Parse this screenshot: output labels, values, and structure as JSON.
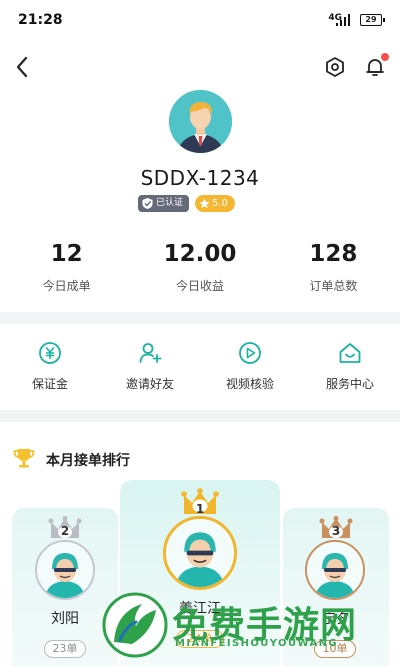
{
  "status_bar": {
    "time": "21:28",
    "network": "4G",
    "battery": "29"
  },
  "nav": {
    "back_icon": "chevron-left-icon",
    "settings_icon": "hexagon-settings-icon",
    "bell_icon": "bell-icon",
    "has_notification": true
  },
  "profile": {
    "username": "SDDX-1234",
    "verified_label": "已认证",
    "rating": "5.0",
    "avatar_icon": "user-avatar-icon"
  },
  "stats": [
    {
      "value": "12",
      "label": "今日成单"
    },
    {
      "value": "12.00",
      "label": "今日收益"
    },
    {
      "value": "128",
      "label": "订单总数"
    }
  ],
  "quick_actions": [
    {
      "label": "保证金",
      "icon": "yuan-coin-icon"
    },
    {
      "label": "邀请好友",
      "icon": "add-user-icon"
    },
    {
      "label": "视频核验",
      "icon": "play-video-icon"
    },
    {
      "label": "服务中心",
      "icon": "home-service-icon"
    }
  ],
  "ranking": {
    "title": "本月接单排行",
    "first": {
      "rank": "1",
      "name": "姜江江",
      "count": "24单"
    },
    "second": {
      "rank": "2",
      "name": "刘阳",
      "count": "23单"
    },
    "third": {
      "rank": "3",
      "name": "宁夕",
      "count": "10单"
    }
  },
  "watermark": {
    "text": "免费手游网",
    "sub": "MIANFEISHOUYOUWANG"
  },
  "colors": {
    "accent": "#17b3a3",
    "gold": "#f5b731",
    "silver": "#b9bcc3",
    "bronze": "#c8915e",
    "watermark": "#2ea14a"
  }
}
